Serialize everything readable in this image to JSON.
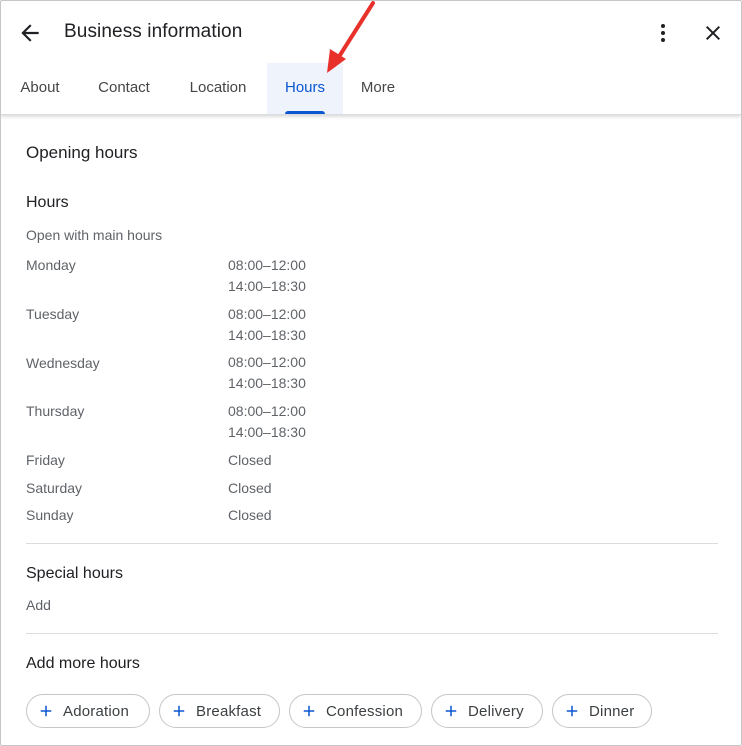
{
  "header": {
    "title": "Business information"
  },
  "tabs": [
    {
      "label": "About",
      "active": false
    },
    {
      "label": "Contact",
      "active": false
    },
    {
      "label": "Location",
      "active": false
    },
    {
      "label": "Hours",
      "active": true
    },
    {
      "label": "More",
      "active": false
    }
  ],
  "opening_hours": {
    "section_title": "Opening hours",
    "hours_title": "Hours",
    "status": "Open with main hours",
    "days": [
      {
        "day": "Monday",
        "times": [
          "08:00–12:00",
          "14:00–18:30"
        ]
      },
      {
        "day": "Tuesday",
        "times": [
          "08:00–12:00",
          "14:00–18:30"
        ]
      },
      {
        "day": "Wednesday",
        "times": [
          "08:00–12:00",
          "14:00–18:30"
        ]
      },
      {
        "day": "Thursday",
        "times": [
          "08:00–12:00",
          "14:00–18:30"
        ]
      },
      {
        "day": "Friday",
        "times": [
          "Closed"
        ]
      },
      {
        "day": "Saturday",
        "times": [
          "Closed"
        ]
      },
      {
        "day": "Sunday",
        "times": [
          "Closed"
        ]
      }
    ]
  },
  "special_hours": {
    "title": "Special hours",
    "action": "Add"
  },
  "more_hours": {
    "title": "Add more hours",
    "chips": [
      "Adoration",
      "Breakfast",
      "Confession",
      "Delivery",
      "Dinner"
    ]
  },
  "colors": {
    "accent": "#0b57d0",
    "annotation_arrow": "#e8312a"
  }
}
